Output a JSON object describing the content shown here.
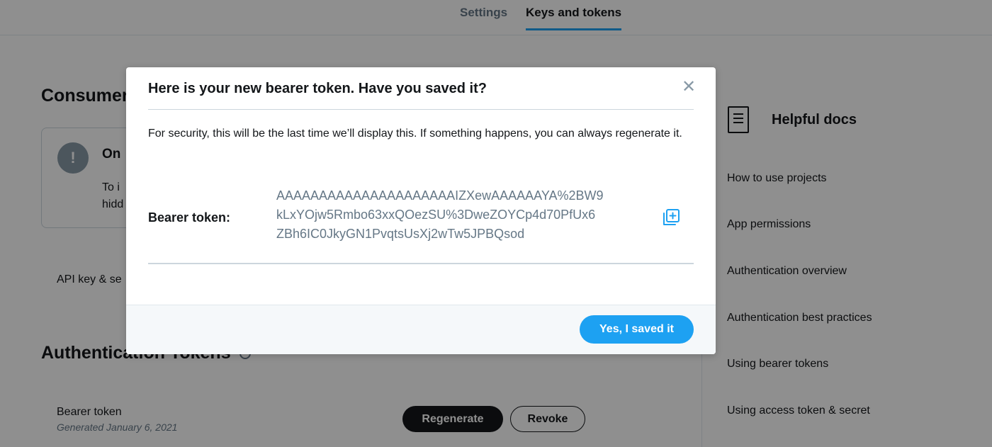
{
  "tabs": [
    {
      "label": "Settings"
    },
    {
      "label": "Keys and tokens"
    }
  ],
  "consumer": {
    "title": "Consumer",
    "notice_title": "On",
    "notice_body_line1": "To i",
    "notice_body_line2": "hidd",
    "api_key_label": "API key & se"
  },
  "auth": {
    "title": "Authentication Tokens",
    "bearer_title": "Bearer token",
    "bearer_generated": "Generated January 6, 2021",
    "regenerate_label": "Regenerate",
    "revoke_label": "Revoke"
  },
  "docs": {
    "title": "Helpful docs",
    "icon": "document-icon",
    "links": [
      {
        "label": "How to use projects"
      },
      {
        "label": "App permissions"
      },
      {
        "label": "Authentication overview"
      },
      {
        "label": "Authentication best practices"
      },
      {
        "label": "Using bearer tokens"
      },
      {
        "label": "Using access token & secret"
      }
    ]
  },
  "modal": {
    "title": "Here is your new bearer token. Have you saved it?",
    "close_icon": "close-icon",
    "message": "For security, this will be the last time we’ll display this. If something happens, you can always regenerate it.",
    "token_label": "Bearer token:",
    "token_lines": [
      "AAAAAAAAAAAAAAAAAAAAAIZXewAAAAAAYA%2BW9",
      "kLxYOjw5Rmbo63xxQOezSU%3DweZOYCp4d70PfUx6",
      "ZBh6IC0JkyGN1PvqtsUsXj2wTw5JPBQsod"
    ],
    "copy_icon": "copy-icon",
    "confirm_label": "Yes, I saved it"
  },
  "colors": {
    "accent": "#1da1f2",
    "text": "#14171a",
    "muted": "#657786"
  }
}
